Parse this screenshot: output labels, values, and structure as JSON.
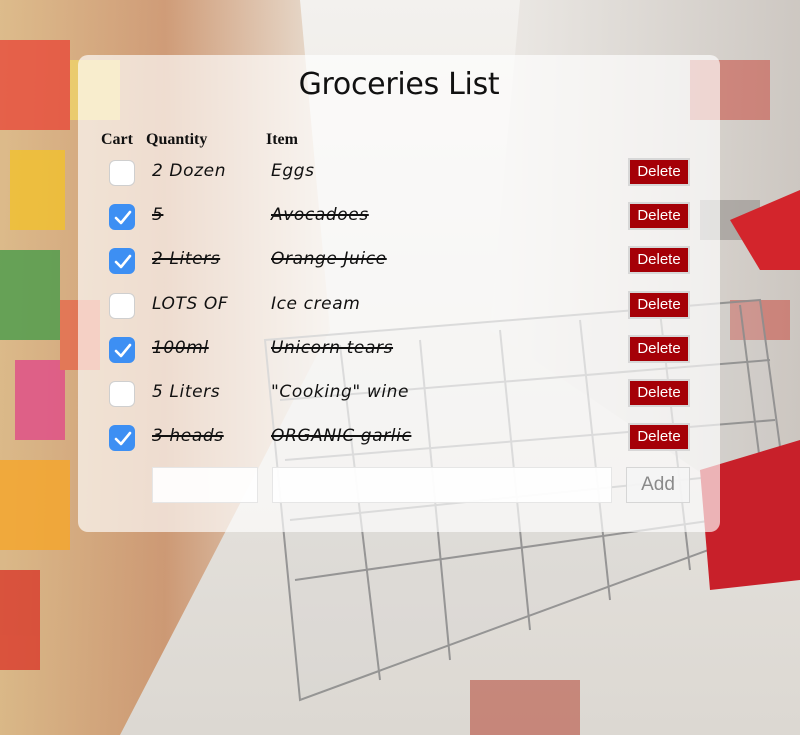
{
  "app": {
    "title": "Groceries List"
  },
  "columns": {
    "cart": "Cart",
    "quantity": "Quantity",
    "item": "Item"
  },
  "items": [
    {
      "in_cart": false,
      "quantity": "2 Dozen",
      "name": "Eggs",
      "delete_label": "Delete"
    },
    {
      "in_cart": true,
      "quantity": "5",
      "name": "Avocadoes",
      "delete_label": "Delete"
    },
    {
      "in_cart": true,
      "quantity": "2 Liters",
      "name": "Orange Juice",
      "delete_label": "Delete"
    },
    {
      "in_cart": false,
      "quantity": "LOTS OF",
      "name": "Ice cream",
      "delete_label": "Delete"
    },
    {
      "in_cart": true,
      "quantity": "100ml",
      "name": "Unicorn tears",
      "delete_label": "Delete"
    },
    {
      "in_cart": false,
      "quantity": "5 Liters",
      "name": "\"Cooking\" wine",
      "delete_label": "Delete"
    },
    {
      "in_cart": true,
      "quantity": "3 heads",
      "name": "ORGANIC garlic",
      "delete_label": "Delete"
    }
  ],
  "add_form": {
    "quantity_value": "",
    "item_value": "",
    "add_label": "Add"
  },
  "colors": {
    "checkbox_on": "#3d8ff3",
    "delete_button": "#a50007"
  },
  "icons": {
    "checked": "checkmark-icon"
  }
}
